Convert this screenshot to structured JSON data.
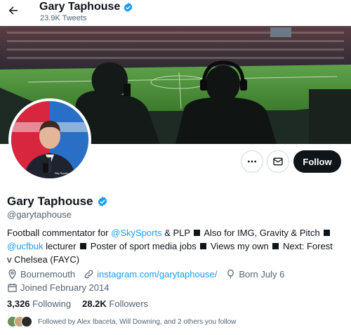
{
  "header": {
    "back_icon": "arrow-left-icon",
    "name": "Gary Taphouse",
    "tweet_count": "23.9K Tweets"
  },
  "colors": {
    "accent": "#1d9bf0",
    "follow_bg": "#0f1419",
    "secondary_text": "#536471"
  },
  "actions": {
    "more_icon": "more-icon",
    "message_icon": "mail-icon",
    "follow_label": "Follow"
  },
  "profile": {
    "name": "Gary Taphouse",
    "handle": "@garytaphouse",
    "bio": {
      "t1": "Football commentator for ",
      "m1": "@SkySports",
      "t2": " & PLP ",
      "t3": " Also for IMG, Gravity & Pitch ",
      "m2": "@ucfbuk",
      "t4": " lecturer ",
      "t5": " Poster of sport media jobs ",
      "t6": " Views my own ",
      "t7": " Next: Forest v Chelsea (FAYC)"
    },
    "location": "Bournemouth",
    "website": "instagram.com/garytaphouse/",
    "born": "Born July 6",
    "joined": "Joined February 2014"
  },
  "stats": {
    "following_count": "3,326",
    "following_label": "Following",
    "followers_count": "28.2K",
    "followers_label": "Followers"
  },
  "followed_by": "Followed by Alex Ibaceta, Will Downing, and 2 others you follow"
}
